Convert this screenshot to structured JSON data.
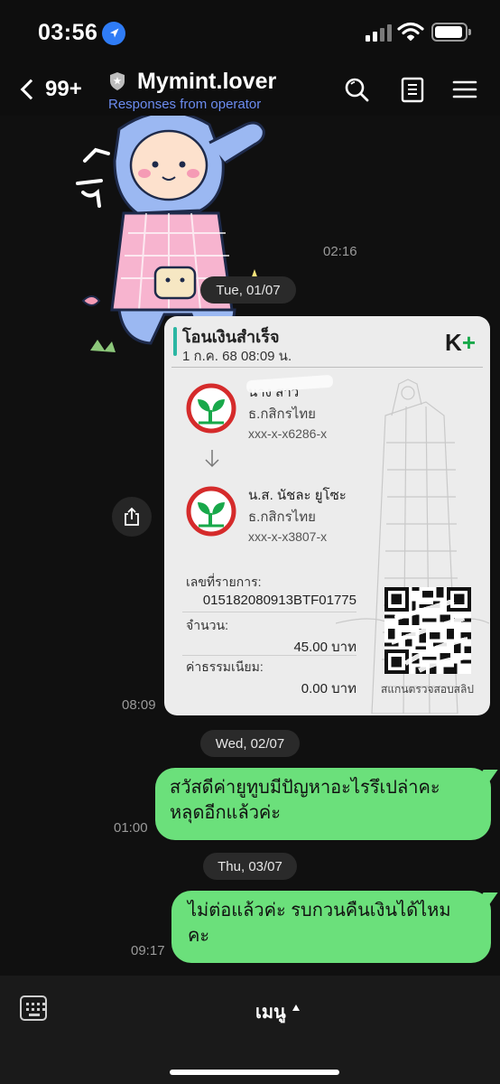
{
  "status_bar": {
    "time": "03:56"
  },
  "header": {
    "back_count": "99+",
    "title": "Mymint.lover",
    "subtitle": "Responses from operator"
  },
  "messages": {
    "sticker_time": "02:16",
    "date_1": "Tue, 01/07",
    "slip_time": "08:09",
    "date_2": "Wed, 02/07",
    "msg_1_line_1": "สวัสดีค่ายูทูบมีปัญหาอะไรรึเปล่าคะ",
    "msg_1_line_2": "หลุดอีกแล้วค่ะ",
    "msg_1_time": "01:00",
    "date_3": "Thu, 03/07",
    "msg_2_line_1": "ไม่ต่อแล้วค่ะ รบกวนคืนเงินได้ไหม",
    "msg_2_line_2": "คะ",
    "msg_2_time": "09:17"
  },
  "slip": {
    "title": "โอนเงินสำเร็จ",
    "datetime": "1 ก.ค. 68  08:09 น.",
    "brand_k": "K",
    "brand_plus": "+",
    "sender_name": "นาง สาว",
    "sender_bank": "ธ.กสิกรไทย",
    "sender_account": "xxx-x-x6286-x",
    "receiver_name": "น.ส. นัชละ ยูโซะ",
    "receiver_bank": "ธ.กสิกรไทย",
    "receiver_account": "xxx-x-x3807-x",
    "ref_label": "เลขที่รายการ:",
    "ref_value": "015182080913BTF01775",
    "amount_label": "จำนวน:",
    "amount_value": "45.00 บาท",
    "fee_label": "ค่าธรรมเนียม:",
    "fee_value": "0.00 บาท",
    "qr_caption": "สแกนตรวจสอบสลิป"
  },
  "bottom": {
    "menu_label": "เมนู"
  },
  "colors": {
    "background": "#101010",
    "outgoing_bubble": "#6be07b",
    "subtitle": "#6c8cf0",
    "kbank_green": "#18a84a"
  }
}
